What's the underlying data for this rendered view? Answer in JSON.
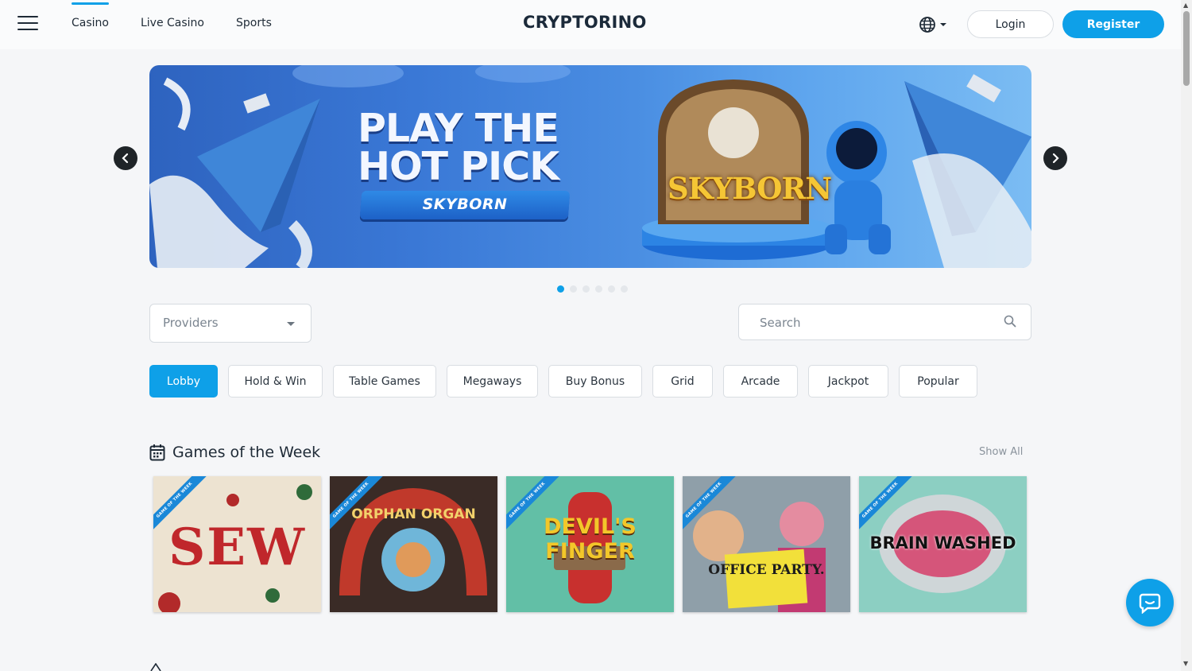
{
  "header": {
    "nav": [
      {
        "label": "Casino",
        "active": true
      },
      {
        "label": "Live Casino",
        "active": false
      },
      {
        "label": "Sports",
        "active": false
      }
    ],
    "logo": "CRYPTORINO",
    "login_label": "Login",
    "register_label": "Register",
    "language_icon": "globe-icon"
  },
  "banner": {
    "title_line1": "PLAY THE",
    "title_line2": "HOT PICK",
    "subtitle": "SKYBORN",
    "game_logo": "SKYBORN",
    "slide_count": 6,
    "active_slide": 0
  },
  "filters": {
    "providers_label": "Providers",
    "search_placeholder": "Search",
    "categories": [
      {
        "label": "Lobby",
        "active": true
      },
      {
        "label": "Hold & Win",
        "active": false
      },
      {
        "label": "Table Games",
        "active": false
      },
      {
        "label": "Megaways",
        "active": false
      },
      {
        "label": "Buy Bonus",
        "active": false
      },
      {
        "label": "Grid",
        "active": false
      },
      {
        "label": "Arcade",
        "active": false
      },
      {
        "label": "Jackpot",
        "active": false
      },
      {
        "label": "Popular",
        "active": false
      }
    ]
  },
  "games_of_week": {
    "title": "Games of the Week",
    "show_all_label": "Show All",
    "ribbon_label": "GAME OF THE WEEK",
    "games": [
      {
        "title": "SEW"
      },
      {
        "title": "ORPHAN ORGAN"
      },
      {
        "title": "DEVIL'S FINGER"
      },
      {
        "title": "OFFICE PARTY."
      },
      {
        "title": "BRAIN WASHED"
      }
    ]
  },
  "colors": {
    "accent": "#0ea0e8",
    "text": "#1e2a36",
    "background": "#f5f6f8"
  }
}
